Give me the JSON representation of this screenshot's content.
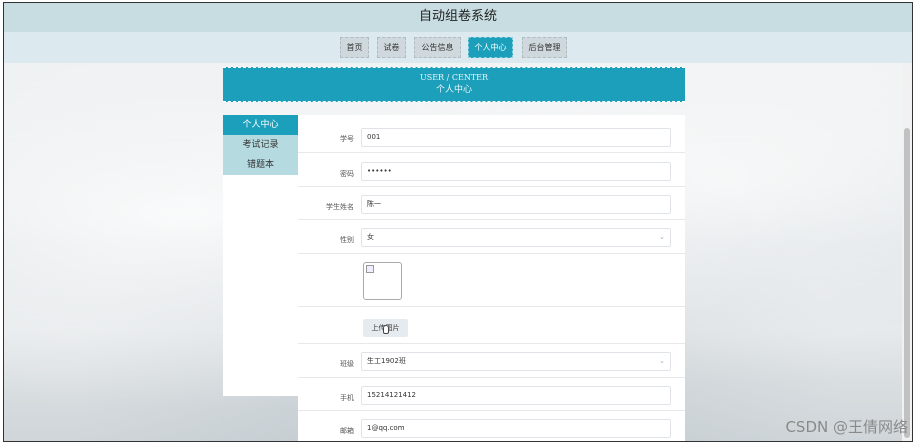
{
  "app": {
    "title": "自动组卷系统"
  },
  "nav": {
    "items": [
      "首页",
      "试卷",
      "公告信息",
      "个人中心",
      "后台管理"
    ],
    "active": "个人中心"
  },
  "banner": {
    "en": "USER / CENTER",
    "cn": "个人中心"
  },
  "sidebar": {
    "items": [
      "个人中心",
      "考试记录",
      "错题本"
    ]
  },
  "form": {
    "student_id": {
      "label": "学号",
      "value": "001"
    },
    "password": {
      "label": "密码",
      "value": "••••••"
    },
    "name": {
      "label": "学生姓名",
      "value": "陈一"
    },
    "gender": {
      "label": "性别",
      "value": "女"
    },
    "upload_label": "上传图片",
    "class": {
      "label": "班级",
      "value": "生工1902班"
    },
    "phone": {
      "label": "手机",
      "value": "15214121412"
    },
    "email": {
      "label": "邮箱",
      "value": "1@qq.com"
    }
  },
  "watermark": "CSDN @王倩网络",
  "colors": {
    "accent": "#1c9fbb",
    "titlebar": "#c8dde1",
    "sidebar_item": "#b5dbe1"
  }
}
